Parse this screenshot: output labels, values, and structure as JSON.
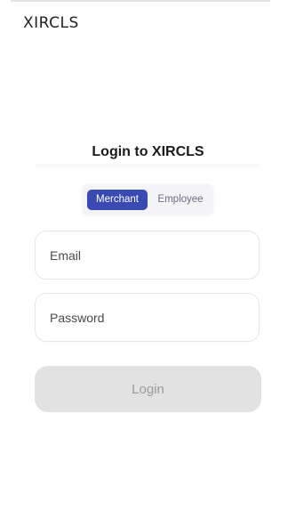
{
  "brand": {
    "logo_text": "XIRCLS"
  },
  "login": {
    "title": "Login to XIRCLS",
    "tabs": {
      "merchant_label": "Merchant",
      "employee_label": "Employee",
      "active": "Merchant"
    },
    "email": {
      "placeholder": "Email",
      "value": ""
    },
    "password": {
      "placeholder": "Password",
      "value": ""
    },
    "submit_label": "Login"
  },
  "colors": {
    "accent": "#3a4ab3",
    "button_disabled_bg": "#e2e2e2",
    "button_disabled_text": "#9b9b9b"
  }
}
